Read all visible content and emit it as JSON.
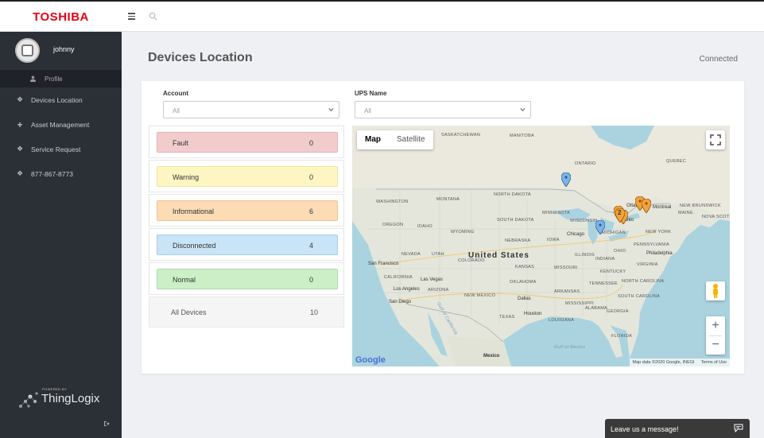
{
  "brand": "TOSHIBA",
  "user": {
    "name": "johnny",
    "profile_label": "Profile"
  },
  "nav": [
    {
      "label": "Devices Location",
      "icon": "tag-icon"
    },
    {
      "label": "Asset Management",
      "icon": "plus-icon"
    },
    {
      "label": "Service Request",
      "icon": "tag-icon"
    },
    {
      "label": "877-867-8773",
      "icon": "tag-icon"
    }
  ],
  "powered": {
    "small": "POWERED BY",
    "name": "ThingLogix"
  },
  "page": {
    "title": "Devices Location",
    "connection": "Connected"
  },
  "filters": {
    "account": {
      "label": "Account",
      "value": "All"
    },
    "ups": {
      "label": "UPS Name",
      "value": "All"
    }
  },
  "statuses": [
    {
      "name": "Fault",
      "count": "0",
      "color": "#f2cccd"
    },
    {
      "name": "Warning",
      "count": "0",
      "color": "#fdf6c3"
    },
    {
      "name": "Informational",
      "count": "6",
      "color": "#fbdcb4"
    },
    {
      "name": "Disconnected",
      "count": "4",
      "color": "#c9e4f6"
    },
    {
      "name": "Normal",
      "count": "0",
      "color": "#ccefc8"
    }
  ],
  "all_devices": {
    "name": "All Devices",
    "count": "10"
  },
  "map": {
    "type_map": "Map",
    "type_satellite": "Satellite",
    "country_label": "United States",
    "labels": [
      "SASKATCHEWAN",
      "MANITOBA",
      "ONTARIO",
      "QUEBEC",
      "NORTH DAKOTA",
      "SOUTH DAKOTA",
      "MONTANA",
      "WASHINGTON",
      "OREGON",
      "IDAHO",
      "WYOMING",
      "NEBRASKA",
      "NEVADA",
      "UTAH",
      "COLORADO",
      "KANSAS",
      "MISSOURI",
      "CALIFORNIA",
      "ARIZONA",
      "NEW MEXICO",
      "OKLAHOMA",
      "TEXAS",
      "IOWA",
      "ILLINOIS",
      "MINNESOTA",
      "WISCONSIN",
      "MICHIGAN",
      "OHIO",
      "INDIANA",
      "KENTUCKY",
      "TENNESSEE",
      "ARKANSAS",
      "MISSISSIPPI",
      "ALABAMA",
      "GEORGIA",
      "FLORIDA",
      "LOUISIANA",
      "SOUTH CAROLINA",
      "NORTH CAROLINA",
      "VIRGINIA",
      "PENNSYLVANIA",
      "NEW YORK",
      "MAINE",
      "NEW BRUNSWICK",
      "NOVA SCOTIA"
    ],
    "cities": [
      "Chicago",
      "San Francisco",
      "Las Vegas",
      "Los Angeles",
      "San Diego",
      "Dallas",
      "Houston",
      "Ottawa",
      "Toronto",
      "Montreal",
      "Philadelphia"
    ],
    "water_labels": [
      "Gulf of California",
      "Gulf of Mexico"
    ],
    "mexico": "Mexico",
    "google": "Google",
    "attribution_data": "Map data ©2020 Google, INEGI",
    "attribution_terms": "Terms of Use",
    "cluster_count": "2"
  },
  "chat": {
    "label": "Leave us a message!"
  }
}
